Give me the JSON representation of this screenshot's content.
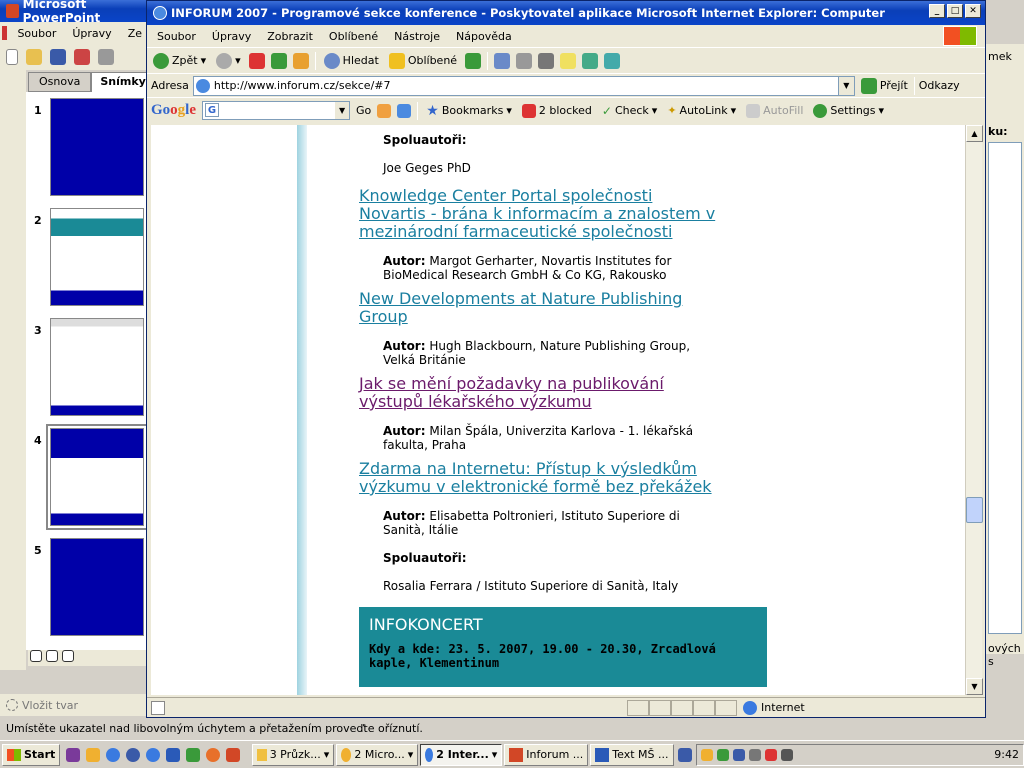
{
  "ppt": {
    "title": "Microsoft PowerPoint",
    "menu": [
      "Soubor",
      "Úpravy",
      "Ze"
    ],
    "tabs": [
      "Osnova",
      "Snímky"
    ],
    "slide_numbers": [
      "1",
      "2",
      "3",
      "4",
      "5"
    ],
    "right_clip1": "mek",
    "right_clip2": "ku:",
    "right_clip3": "ových s",
    "draw_label": "Vložit tvar",
    "status": "Umístěte ukazatel nad libovolným úchytem a přetažením proveďte oříznutí."
  },
  "ie": {
    "title": "INFORUM 2007 - Programové sekce konference - Poskytovatel aplikace Microsoft Internet Explorer: Computer",
    "menu": [
      "Soubor",
      "Úpravy",
      "Zobrazit",
      "Oblíbené",
      "Nástroje",
      "Nápověda"
    ],
    "toolbar": {
      "back": "Zpět",
      "search": "Hledat",
      "favorites": "Oblíbené"
    },
    "address_label": "Adresa",
    "url": "http://www.inforum.cz/sekce/#7",
    "go": "Přejít",
    "links": "Odkazy",
    "google": {
      "go": "Go",
      "bookmarks": "Bookmarks",
      "blocked": "2 blocked",
      "check": "Check",
      "autolink": "AutoLink",
      "autofill": "AutoFill",
      "settings": "Settings"
    },
    "status_zone": "Internet"
  },
  "content": {
    "coauthors_label": "Spoluautoři:",
    "coauthor1": "Joe Geges PhD",
    "articles": [
      {
        "title": [
          "Knowledge Center Portal společnosti",
          "Novartis - brána k informacím a znalostem v",
          "mezinárodní farmaceutické společnosti"
        ],
        "author_label": "Autor:",
        "author": [
          "Margot Gerharter, Novartis Institutes for",
          "BioMedical Research GmbH & Co KG, Rakousko"
        ]
      },
      {
        "title": [
          "New Developments at Nature Publishing",
          "Group"
        ],
        "author_label": "Autor:",
        "author": [
          "Hugh Blackbourn, Nature Publishing Group,",
          "Velká Británie"
        ]
      },
      {
        "title": [
          "Jak se mění požadavky na publikování",
          "výstupů lékařského výzkumu"
        ],
        "author_label": "Autor:",
        "author": [
          "Milan Špála, Univerzita Karlova - 1. lékařská",
          "fakulta, Praha"
        ]
      },
      {
        "title": [
          "Zdarma na Internetu: Přístup k výsledkům",
          "výzkumu v elektronické formě bez překážek"
        ],
        "author_label": "Autor:",
        "author": [
          "Elisabetta Poltronieri, Istituto Superiore di",
          "Sanità, Itálie"
        ]
      }
    ],
    "coauthor2": "Rosalia Ferrara / Istituto Superiore di Sanità, Italy",
    "info_title": "INFOKONCERT",
    "info_when_label": "Kdy a kde:",
    "info_when": "23. 5. 2007, 19.00 - 20.30, Zrcadlová",
    "info_place": "kaple, Klementinum"
  },
  "taskbar": {
    "start": "Start",
    "items": [
      "3 Průzk...",
      "2 Micro...",
      "2 Inter...",
      "Inforum ...",
      "Text MŠ ..."
    ],
    "clock": "9:42"
  },
  "colors": {
    "teal": "#1a8a96",
    "link": "#1a7fa0",
    "visited": "#6b1a6b",
    "slide_blue": "#0000a8"
  }
}
